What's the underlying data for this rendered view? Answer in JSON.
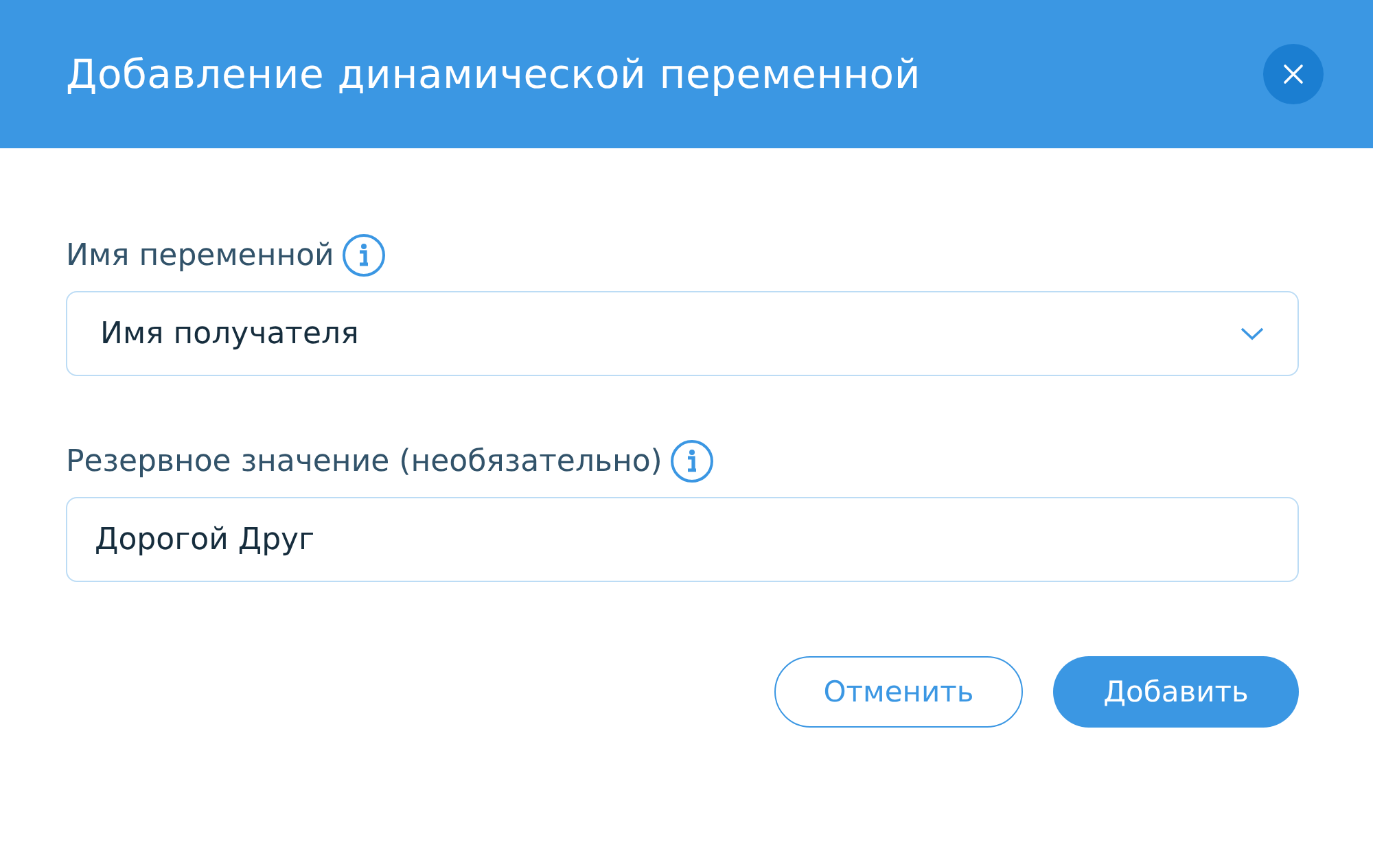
{
  "dialog": {
    "title": "Добавление динамической переменной"
  },
  "fields": [
    {
      "kind": "dropdown",
      "label": "Имя переменной",
      "value": "Имя получателя"
    },
    {
      "kind": "text",
      "label": "Резервное значение (необязательно)",
      "value": "Дорогой Друг"
    }
  ],
  "buttons": [
    {
      "kind": "secondary",
      "label": "Отменить"
    },
    {
      "kind": "primary",
      "label": "Добавить"
    }
  ]
}
